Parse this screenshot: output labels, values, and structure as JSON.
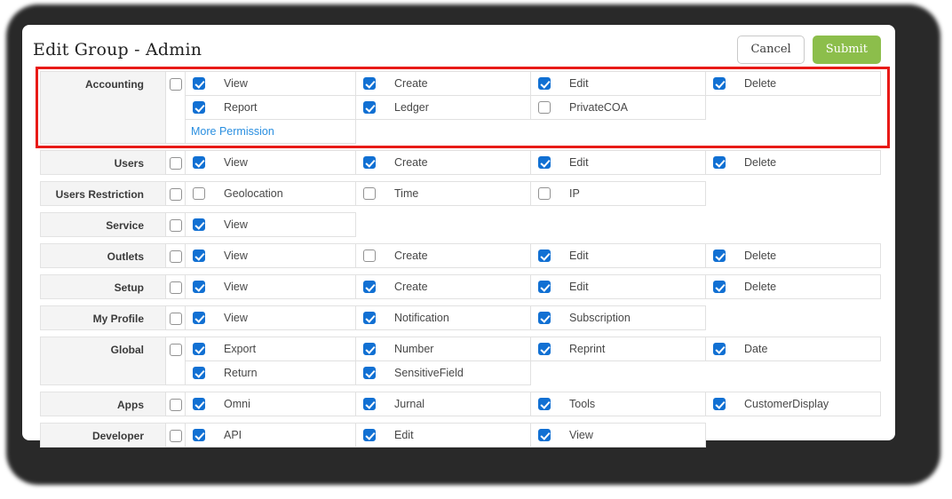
{
  "header": {
    "title": "Edit Group - Admin",
    "cancel_label": "Cancel",
    "submit_label": "Submit"
  },
  "colors": {
    "checkbox_blue": "#1170d3",
    "link_blue": "#2a8fe0",
    "submit_green": "#8cbe4b",
    "annotation_red": "#e81a17",
    "row_label_bg": "#f4f4f4",
    "cell_border": "#e1e1e1"
  },
  "groups": [
    {
      "name": "Accounting",
      "group_checked": false,
      "highlighted": true,
      "lines": [
        [
          {
            "label": "View",
            "checked": true
          },
          {
            "label": "Create",
            "checked": true
          },
          {
            "label": "Edit",
            "checked": true
          },
          {
            "label": "Delete",
            "checked": true
          }
        ],
        [
          {
            "label": "Report",
            "checked": true
          },
          {
            "label": "Ledger",
            "checked": true
          },
          {
            "label": "PrivateCOA",
            "checked": false
          }
        ]
      ],
      "more_link": "More Permission"
    },
    {
      "name": "Users",
      "group_checked": false,
      "highlighted": false,
      "lines": [
        [
          {
            "label": "View",
            "checked": true
          },
          {
            "label": "Create",
            "checked": true
          },
          {
            "label": "Edit",
            "checked": true
          },
          {
            "label": "Delete",
            "checked": true
          }
        ]
      ]
    },
    {
      "name": "Users Restriction",
      "group_checked": false,
      "highlighted": false,
      "lines": [
        [
          {
            "label": "Geolocation",
            "checked": false
          },
          {
            "label": "Time",
            "checked": false
          },
          {
            "label": "IP",
            "checked": false
          }
        ]
      ]
    },
    {
      "name": "Service",
      "group_checked": false,
      "highlighted": false,
      "lines": [
        [
          {
            "label": "View",
            "checked": true
          }
        ]
      ]
    },
    {
      "name": "Outlets",
      "group_checked": false,
      "highlighted": false,
      "lines": [
        [
          {
            "label": "View",
            "checked": true
          },
          {
            "label": "Create",
            "checked": false
          },
          {
            "label": "Edit",
            "checked": true
          },
          {
            "label": "Delete",
            "checked": true
          }
        ]
      ]
    },
    {
      "name": "Setup",
      "group_checked": false,
      "highlighted": false,
      "lines": [
        [
          {
            "label": "View",
            "checked": true
          },
          {
            "label": "Create",
            "checked": true
          },
          {
            "label": "Edit",
            "checked": true
          },
          {
            "label": "Delete",
            "checked": true
          }
        ]
      ]
    },
    {
      "name": "My Profile",
      "group_checked": false,
      "highlighted": false,
      "lines": [
        [
          {
            "label": "View",
            "checked": true
          },
          {
            "label": "Notification",
            "checked": true
          },
          {
            "label": "Subscription",
            "checked": true
          }
        ]
      ]
    },
    {
      "name": "Global",
      "group_checked": false,
      "highlighted": false,
      "lines": [
        [
          {
            "label": "Export",
            "checked": true
          },
          {
            "label": "Number",
            "checked": true
          },
          {
            "label": "Reprint",
            "checked": true
          },
          {
            "label": "Date",
            "checked": true
          }
        ],
        [
          {
            "label": "Return",
            "checked": true
          },
          {
            "label": "SensitiveField",
            "checked": true
          }
        ]
      ]
    },
    {
      "name": "Apps",
      "group_checked": false,
      "highlighted": false,
      "lines": [
        [
          {
            "label": "Omni",
            "checked": true
          },
          {
            "label": "Jurnal",
            "checked": true
          },
          {
            "label": "Tools",
            "checked": true
          },
          {
            "label": "CustomerDisplay",
            "checked": true
          }
        ]
      ]
    },
    {
      "name": "Developer",
      "group_checked": false,
      "highlighted": false,
      "lines": [
        [
          {
            "label": "API",
            "checked": true
          },
          {
            "label": "Edit",
            "checked": true
          },
          {
            "label": "View",
            "checked": true
          }
        ]
      ]
    }
  ]
}
